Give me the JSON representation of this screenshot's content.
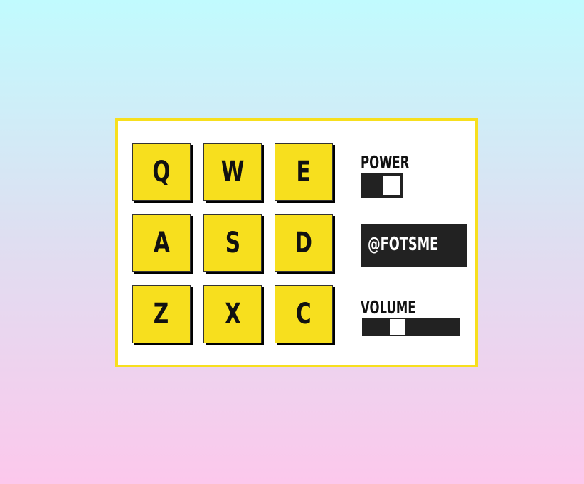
{
  "pads": [
    {
      "key": "Q"
    },
    {
      "key": "W"
    },
    {
      "key": "E"
    },
    {
      "key": "A"
    },
    {
      "key": "S"
    },
    {
      "key": "D"
    },
    {
      "key": "Z"
    },
    {
      "key": "X"
    },
    {
      "key": "C"
    }
  ],
  "controls": {
    "power_label": "POWER",
    "power_on": true,
    "display_text": "@FOTSME",
    "volume_label": "VOLUME",
    "volume_level": 0.34
  },
  "colors": {
    "accent": "#f7df1e",
    "dark": "#222222",
    "panel": "#ffffff",
    "bg_top": "#c1fbfe",
    "bg_bottom": "#fcc8ec"
  }
}
